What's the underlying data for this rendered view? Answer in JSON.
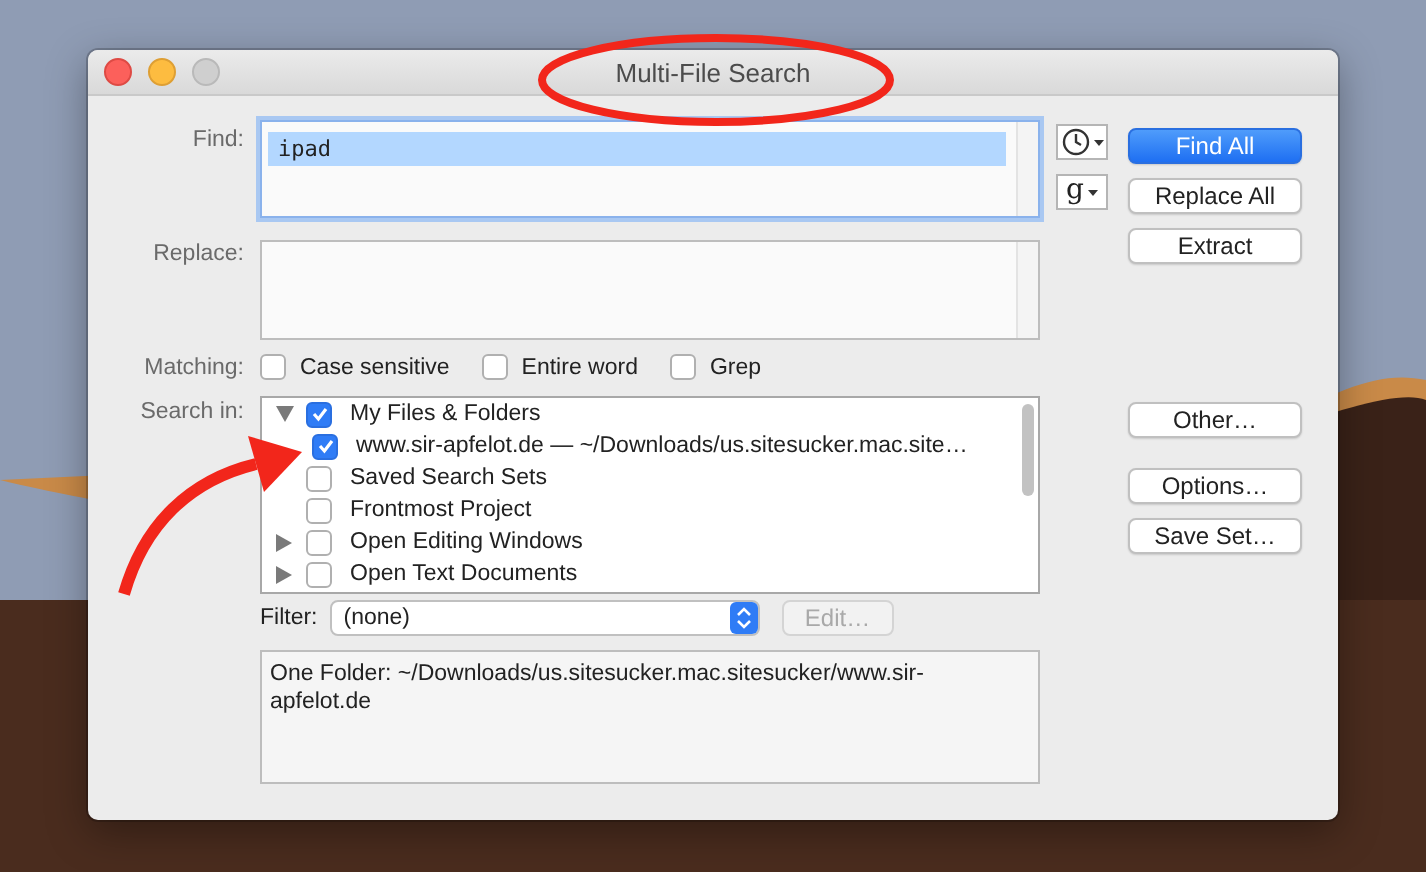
{
  "window": {
    "title": "Multi-File Search"
  },
  "find": {
    "label": "Find:",
    "value": "ipad",
    "text_selected": true
  },
  "pattern_button": {
    "label": "g"
  },
  "actions": [
    {
      "label": "Find All",
      "default": true
    },
    {
      "label": "Replace All",
      "default": false
    },
    {
      "label": "Extract",
      "default": false
    }
  ],
  "replace": {
    "label": "Replace:"
  },
  "matching": {
    "label": "Matching:",
    "options": [
      {
        "label": "Case sensitive",
        "checked": false
      },
      {
        "label": "Entire word",
        "checked": false
      },
      {
        "label": "Grep",
        "checked": false
      }
    ]
  },
  "search_in": {
    "label": "Search in:",
    "items": [
      {
        "label": "My Files & Folders",
        "checked": true,
        "kind": "group",
        "expanded": true,
        "children": [
          {
            "label": "www.sir-apfelot.de — ~/Downloads/us.sitesucker.mac.site…",
            "checked": true,
            "kind": "item"
          }
        ]
      },
      {
        "label": "Saved Search Sets",
        "checked": false,
        "kind": "item"
      },
      {
        "label": "Frontmost Project",
        "checked": false,
        "kind": "item"
      },
      {
        "label": "Open Editing Windows",
        "checked": false,
        "kind": "group",
        "expanded": false
      },
      {
        "label": "Open Text Documents",
        "checked": false,
        "kind": "group",
        "expanded": false
      }
    ]
  },
  "set_buttons": [
    {
      "label": "Other…",
      "kind": "top"
    },
    {
      "label": "Options…",
      "kind": "group"
    },
    {
      "label": "Save Set…",
      "kind": "group"
    }
  ],
  "filter": {
    "label": "Filter:",
    "value": "(none)",
    "edit_button": {
      "label": "Edit…",
      "disabled": true
    }
  },
  "description": "One Folder: ~/Downloads/us.sitesucker.mac.sitesucker/www.sir-apfelot.de"
}
